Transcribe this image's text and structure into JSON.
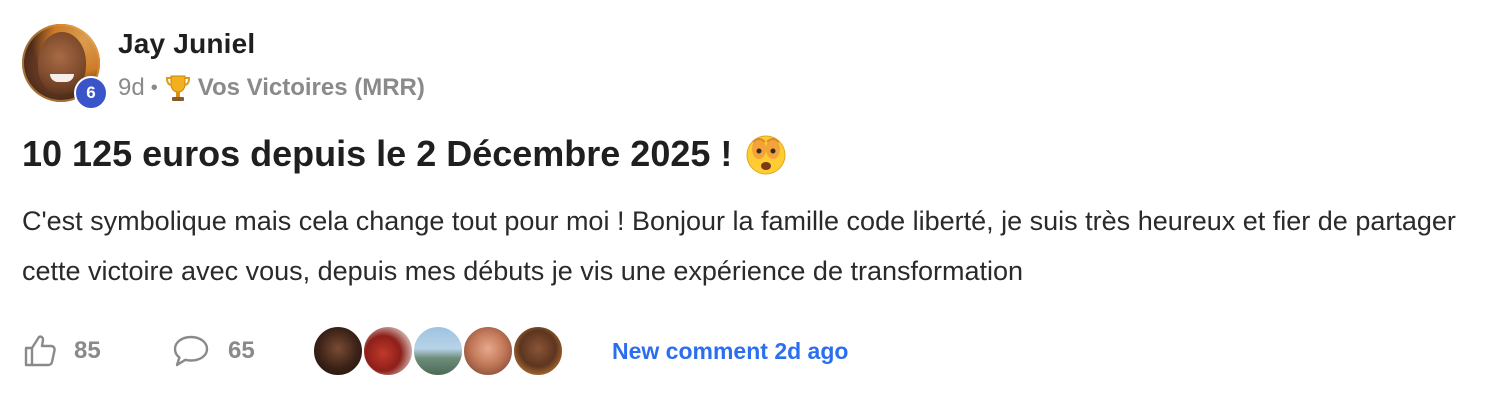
{
  "author": {
    "name": "Jay Juniel",
    "level": "6"
  },
  "meta": {
    "time_ago": "9d",
    "separator": "•",
    "category_icon": "trophy-icon",
    "category": "Vos Victoires (MRR)"
  },
  "post": {
    "title": "10 125 euros depuis le 2 Décembre 2025 !",
    "title_emoji": "face-with-peeking-eye-icon",
    "body": "C'est symbolique mais cela change tout pour moi ! Bonjour la famille code liberté, je suis très heureux et fier de partager cette victoire avec vous, depuis mes débuts je vis une expérience de transformation"
  },
  "footer": {
    "likes_count": "85",
    "comments_count": "65",
    "commenter_avatars": [
      "avatar-1",
      "avatar-2",
      "avatar-3",
      "avatar-4",
      "avatar-5"
    ],
    "new_comment_label": "New comment 2d ago"
  },
  "colors": {
    "level_badge": "#3a55c9",
    "link": "#2b6ff0",
    "muted": "#8a8a8a",
    "text": "#1f1f1f"
  }
}
